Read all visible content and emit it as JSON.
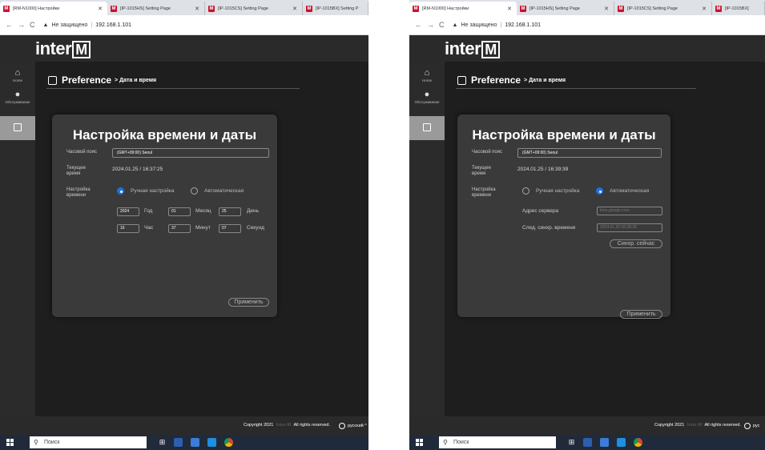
{
  "screenshots": [
    {
      "browser": {
        "tabs": [
          {
            "title": "[RM-N1000] Настройки",
            "active": true
          },
          {
            "title": "[IP-1015HS] Setting Page",
            "active": false
          },
          {
            "title": "[IP-1015CS] Setting Page",
            "active": false
          },
          {
            "title": "[IP-1015BX] Setting P",
            "active": false
          }
        ],
        "security_warning": "Не защищено",
        "url": "192.168.1.101"
      },
      "app": {
        "logo": "interM",
        "sidebar": [
          {
            "label": "Home",
            "icon": "home-icon"
          },
          {
            "label": "Обслуживание",
            "icon": "maintenance-icon"
          }
        ],
        "page_title": "Preference",
        "page_subtitle": "> Дата и время",
        "card_title": "Настройка времени и даты",
        "timezone_label": "Часовой пояс",
        "timezone_value": "(GMT+09:00) Seoul",
        "current_time_label": "Текущее время",
        "current_time_value": "2024.01.25 / 16:37:25",
        "time_setting_label": "Настройка времени",
        "mode_manual": "Ручная настройка",
        "mode_auto": "Автоматическая",
        "selected_mode": "manual",
        "year_value": "2024",
        "year_label": "Год",
        "month_value": "01",
        "month_label": "Месяц",
        "day_value": "25",
        "day_label": "День",
        "hour_value": "16",
        "hour_label": "Час",
        "minute_value": "37",
        "minute_label": "Минут",
        "second_value": "07",
        "second_label": "Секунд",
        "apply_button": "Применить"
      },
      "footer": {
        "copyright_prefix": "Copyright 2021",
        "copyright_brand": "Inter-M",
        "copyright_suffix": "All rights reserved.",
        "language": "русский ^"
      },
      "taskbar": {
        "search": "Поиск"
      }
    },
    {
      "browser": {
        "tabs": [
          {
            "title": "[RM-N1000] Настройки",
            "active": true
          },
          {
            "title": "[IP-1015HS] Setting Page",
            "active": false
          },
          {
            "title": "[IP-1015CS] Setting Page",
            "active": false
          },
          {
            "title": "[IP-1015BX]",
            "active": false
          }
        ],
        "security_warning": "Не защищено",
        "url": "192.168.1.101"
      },
      "app": {
        "logo": "interM",
        "sidebar": [
          {
            "label": "Home",
            "icon": "home-icon"
          },
          {
            "label": "Обслуживание",
            "icon": "maintenance-icon"
          }
        ],
        "page_title": "Preference",
        "page_subtitle": "> Дата и время",
        "card_title": "Настройка времени и даты",
        "timezone_label": "Часовой пояс",
        "timezone_value": "(GMT+09:00) Seoul",
        "current_time_label": "Текущее время",
        "current_time_value": "2024.01.25 / 16:39:39",
        "time_setting_label": "Настройка времени",
        "mode_manual": "Ручная настройка",
        "mode_auto": "Автоматическая",
        "selected_mode": "auto",
        "server_label": "Адрес сервера",
        "server_placeholder": "time.google.com",
        "next_sync_label": "След. синхр. времени",
        "next_sync_value": "2024.01.26 06:38:28",
        "sync_button": "Синхр. сейчас",
        "apply_button": "Применить"
      },
      "footer": {
        "copyright_prefix": "Copyright 2021",
        "copyright_brand": "Inter-M",
        "copyright_suffix": "All rights reserved.",
        "language": "рус"
      },
      "taskbar": {
        "search": "Поиск"
      }
    }
  ]
}
